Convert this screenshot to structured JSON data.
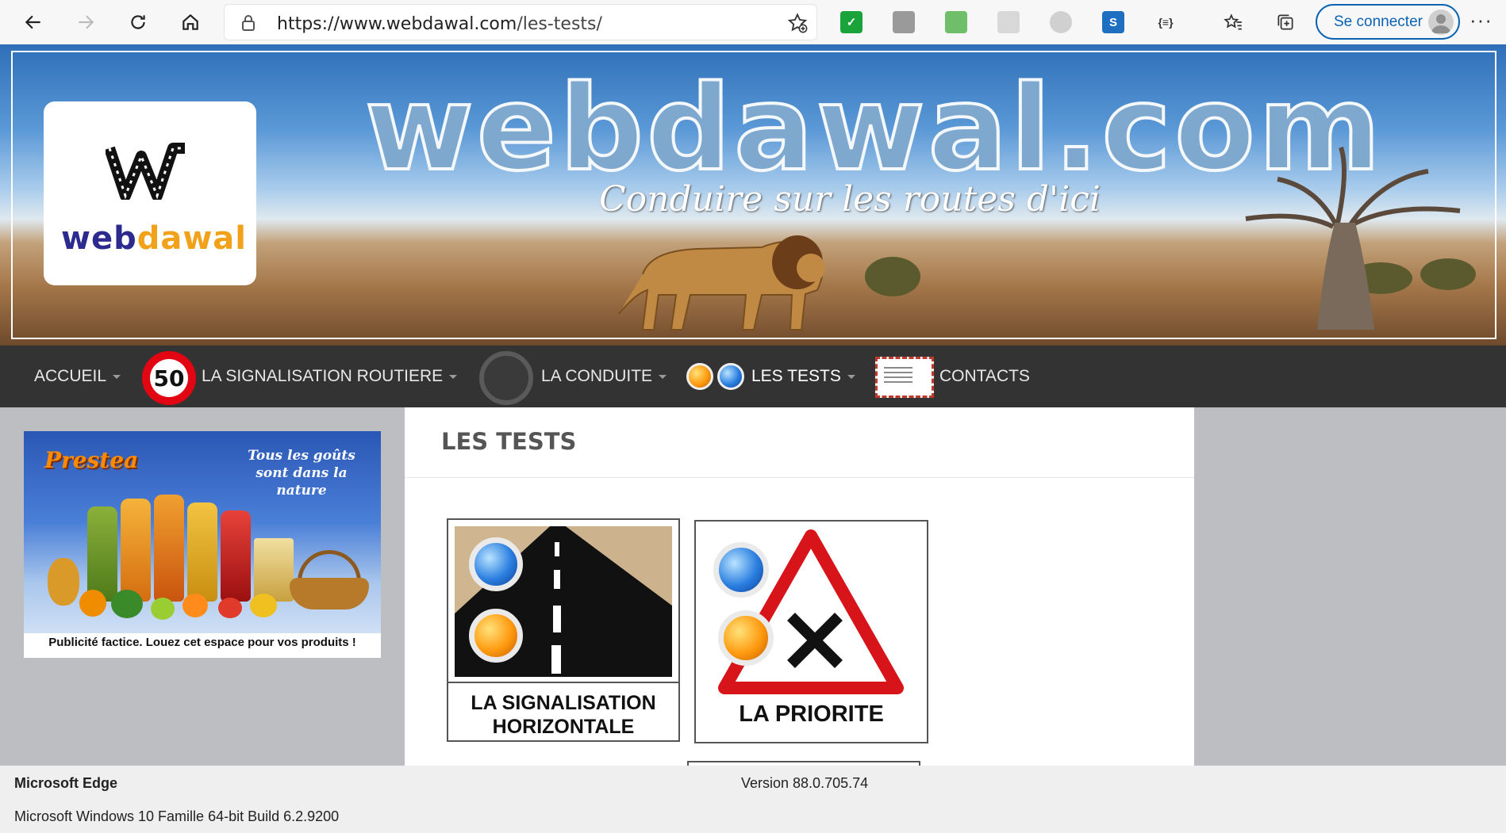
{
  "browser": {
    "url_host": "https://www.webdawal.com",
    "url_path": "/les-tests/",
    "signin_label": "Se connecter",
    "more_label": "···"
  },
  "banner": {
    "site_title": "webdawal.com",
    "tagline": "Conduire sur les routes d'ici",
    "logo_text_main": "web",
    "logo_text_accent": "dawal"
  },
  "nav": {
    "items": [
      {
        "label": "ACCUEIL"
      },
      {
        "label": "LA SIGNALISATION ROUTIERE",
        "icon_text": "50"
      },
      {
        "label": "LA CONDUITE"
      },
      {
        "label": "LES TESTS"
      },
      {
        "label": "CONTACTS"
      }
    ]
  },
  "ad": {
    "brand": "Prestea",
    "slogan": "Tous les goûts sont dans la nature",
    "caption": "Publicité factice. Louez cet espace pour vos produits !"
  },
  "main": {
    "title": "LES TESTS",
    "cards": [
      {
        "line1": "LA SIGNALISATION",
        "line2": "HORIZONTALE"
      },
      {
        "line1": "LA PRIORITE"
      }
    ]
  },
  "footer": {
    "app_name": "Microsoft Edge",
    "version": "Version 88.0.705.74",
    "os": "Microsoft Windows 10 Famille 64-bit Build 6.2.9200"
  },
  "colors": {
    "nav_bg": "#333334",
    "accent_blue": "#0a63b3",
    "speed_red": "#e20613",
    "logo_navy": "#2c2a8e",
    "logo_orange": "#f2a21a"
  }
}
